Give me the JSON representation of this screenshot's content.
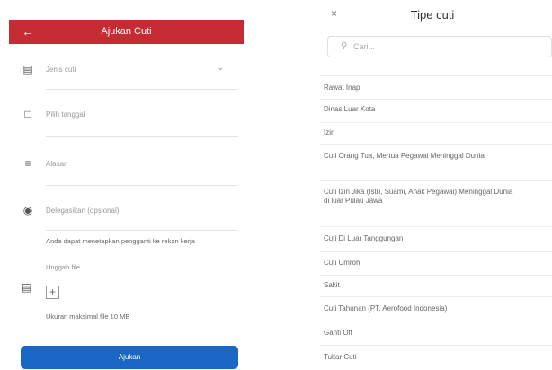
{
  "form": {
    "back_icon": "arrow-left-icon",
    "title": "Ajukan Cuti",
    "fields": [
      {
        "icon": "briefcase-icon",
        "label": "Jenis cuti"
      },
      {
        "icon": "calendar-icon",
        "label": "Pilih tanggal"
      },
      {
        "icon": "lines-icon",
        "label": "Alasan"
      },
      {
        "icon": "user-circle-icon",
        "label": "Delegasikan (opsional)"
      }
    ],
    "delegate_note": "Anda dapat menetapkan pengganti ke rekan kerja",
    "upload_icon": "document-icon",
    "upload_label": "Unggah file",
    "plus": "+",
    "max_size": "Ukuran maksimal file 10 MB",
    "submit_label": "Ajukan",
    "brand_color": "#c62a32",
    "button_color": "#1a66c4"
  },
  "picker": {
    "close": "×",
    "title": "Tipe cuti",
    "search_placeholder": "Cari...",
    "options": [
      "Rawat Inap",
      "Dinas Luar Kota",
      "Izin",
      "Cuti Orang Tua, Mertua Pegawai Meninggal Dunia",
      "Cuti Izin Jika (Istri, Suami, Anak Pegawai) Meninggal Dunia di luar Pulau Jawa",
      "Cuti Di Luar Tanggungan",
      "Cuti Umroh",
      "Sakit",
      "Cuti Tahunan (PT. Aerofood Indonesia)",
      "Ganti Off",
      "Tukar Cuti"
    ]
  }
}
